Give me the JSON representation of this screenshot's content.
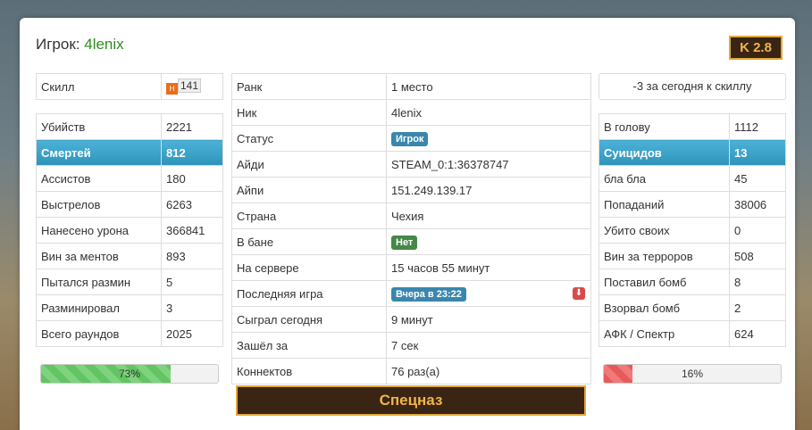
{
  "header": {
    "player_label": "Игрок:",
    "player_name": "4lenix",
    "k_badge": "K 2.8"
  },
  "left": {
    "skill": {
      "label": "Скилл",
      "icon": "H",
      "value": "141"
    },
    "rows": [
      {
        "label": "Убийств",
        "value": "2221",
        "highlight": false
      },
      {
        "label": "Смертей",
        "value": "812",
        "highlight": true
      },
      {
        "label": "Ассистов",
        "value": "180",
        "highlight": false
      },
      {
        "label": "Выстрелов",
        "value": "6263",
        "highlight": false
      },
      {
        "label": "Нанесено урона",
        "value": "366841",
        "highlight": false
      },
      {
        "label": "Вин за ментов",
        "value": "893",
        "highlight": false
      },
      {
        "label": "Пытался размин",
        "value": "5",
        "highlight": false
      },
      {
        "label": "Разминировал",
        "value": "3",
        "highlight": false
      },
      {
        "label": "Всего раундов",
        "value": "2025",
        "highlight": false
      }
    ],
    "progress": {
      "text": "73%",
      "value": 73
    }
  },
  "middle": {
    "rows": [
      {
        "label": "Ранк",
        "value": "1 место"
      },
      {
        "label": "Ник",
        "value": "4lenix"
      },
      {
        "label": "Статус",
        "value": "Игрок",
        "badge": "blue"
      },
      {
        "label": "Айди",
        "value": "STEAM_0:1:36378747"
      },
      {
        "label": "Айпи",
        "value": "151.249.139.17"
      },
      {
        "label": "Страна",
        "value": "Чехия"
      },
      {
        "label": "В бане",
        "value": "Нет",
        "badge": "green"
      },
      {
        "label": "На сервере",
        "value": "15 часов 55 минут"
      },
      {
        "label": "Последняя игра",
        "value": "Вчера в 23:22",
        "badge": "blue"
      },
      {
        "label": "Сыграл сегодня",
        "value": "9 минут"
      },
      {
        "label": "Зашёл за",
        "value": "7 сек"
      },
      {
        "label": "Коннектов",
        "value": "76 раз(а)"
      }
    ],
    "rank_title": "Спецназ"
  },
  "right": {
    "skill_today": "-3 за сегодня к скиллу",
    "rows": [
      {
        "label": "В голову",
        "value": "1112",
        "highlight": false
      },
      {
        "label": "Суицидов",
        "value": "13",
        "highlight": true
      },
      {
        "label": "бла бла",
        "value": "45",
        "highlight": false
      },
      {
        "label": "Попаданий",
        "value": "38006",
        "highlight": false
      },
      {
        "label": "Убито своих",
        "value": "0",
        "highlight": false
      },
      {
        "label": "Вин за терроров",
        "value": "508",
        "highlight": false
      },
      {
        "label": "Поставил бомб",
        "value": "8",
        "highlight": false
      },
      {
        "label": "Взорвал бомб",
        "value": "2",
        "highlight": false
      },
      {
        "label": "АФК / Спектр",
        "value": "624",
        "highlight": false
      }
    ],
    "progress": {
      "text": "16%",
      "value": 16
    }
  },
  "icons": {
    "last_game_action": "download-icon"
  },
  "colors": {
    "accent": "#3a87ad",
    "gold": "#e0a93a",
    "green": "#468847",
    "highlight": "#2f94ba"
  }
}
